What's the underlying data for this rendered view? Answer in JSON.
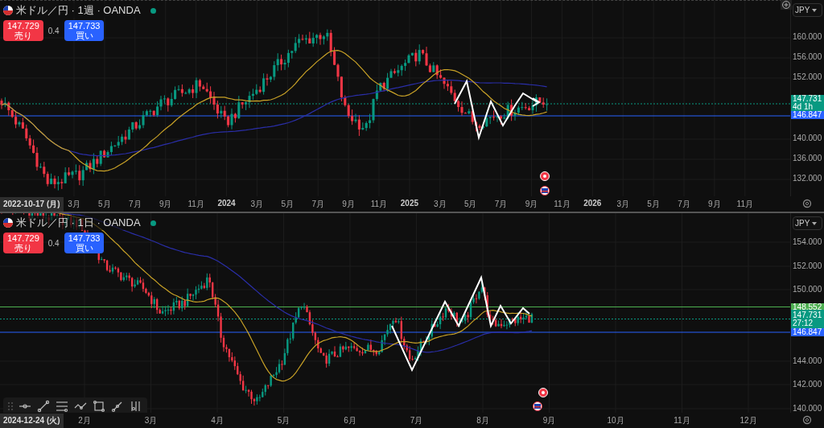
{
  "panes": [
    {
      "title": "米ドル／円 · 1週 · OANDA",
      "market_open": true,
      "sell": {
        "price": "147.729",
        "label": "売り"
      },
      "spread": "0.4",
      "buy": {
        "price": "147.733",
        "label": "買い"
      },
      "currency": "JPY",
      "price_ticks": [
        "160.000",
        "156.000",
        "152.000",
        "140.000",
        "136.000",
        "132.000"
      ],
      "price_badges": [
        {
          "kind": "last",
          "price": "147.731",
          "countdown": "4d 1h"
        },
        {
          "kind": "line",
          "price": "146.847"
        }
      ],
      "date_badge": "2022-10-17 (月)",
      "time_ticks": [
        {
          "label": "3月",
          "kind": "month"
        },
        {
          "label": "5月",
          "kind": "month"
        },
        {
          "label": "7月",
          "kind": "month"
        },
        {
          "label": "9月",
          "kind": "month"
        },
        {
          "label": "11月",
          "kind": "month"
        },
        {
          "label": "2024",
          "kind": "year"
        },
        {
          "label": "3月",
          "kind": "month"
        },
        {
          "label": "5月",
          "kind": "month"
        },
        {
          "label": "7月",
          "kind": "month"
        },
        {
          "label": "9月",
          "kind": "month"
        },
        {
          "label": "11月",
          "kind": "month"
        },
        {
          "label": "2025",
          "kind": "year"
        },
        {
          "label": "3月",
          "kind": "month"
        },
        {
          "label": "5月",
          "kind": "month"
        },
        {
          "label": "7月",
          "kind": "month"
        },
        {
          "label": "9月",
          "kind": "month"
        },
        {
          "label": "11月",
          "kind": "month"
        },
        {
          "label": "2026",
          "kind": "year"
        },
        {
          "label": "3月",
          "kind": "month"
        },
        {
          "label": "5月",
          "kind": "month"
        },
        {
          "label": "7月",
          "kind": "month"
        },
        {
          "label": "9月",
          "kind": "month"
        },
        {
          "label": "11月",
          "kind": "month"
        }
      ]
    },
    {
      "title": "米ドル／円 · 1日 · OANDA",
      "market_open": true,
      "sell": {
        "price": "147.729",
        "label": "売り"
      },
      "spread": "0.4",
      "buy": {
        "price": "147.733",
        "label": "買い"
      },
      "currency": "JPY",
      "price_ticks": [
        "154.000",
        "152.000",
        "150.000",
        "144.000",
        "142.000",
        "140.000"
      ],
      "price_badges": [
        {
          "kind": "alert",
          "price": "148.552"
        },
        {
          "kind": "last",
          "price": "147.731",
          "countdown": "27:12"
        },
        {
          "kind": "line",
          "price": "146.847"
        }
      ],
      "date_badge": "2024-12-24 (火)",
      "time_ticks": [
        {
          "label": "2月",
          "kind": "month"
        },
        {
          "label": "3月",
          "kind": "month"
        },
        {
          "label": "4月",
          "kind": "month"
        },
        {
          "label": "5月",
          "kind": "month"
        },
        {
          "label": "6月",
          "kind": "month"
        },
        {
          "label": "7月",
          "kind": "month"
        },
        {
          "label": "8月",
          "kind": "month"
        },
        {
          "label": "9月",
          "kind": "month"
        },
        {
          "label": "10月",
          "kind": "month"
        },
        {
          "label": "11月",
          "kind": "month"
        },
        {
          "label": "12月",
          "kind": "month"
        }
      ]
    }
  ]
}
